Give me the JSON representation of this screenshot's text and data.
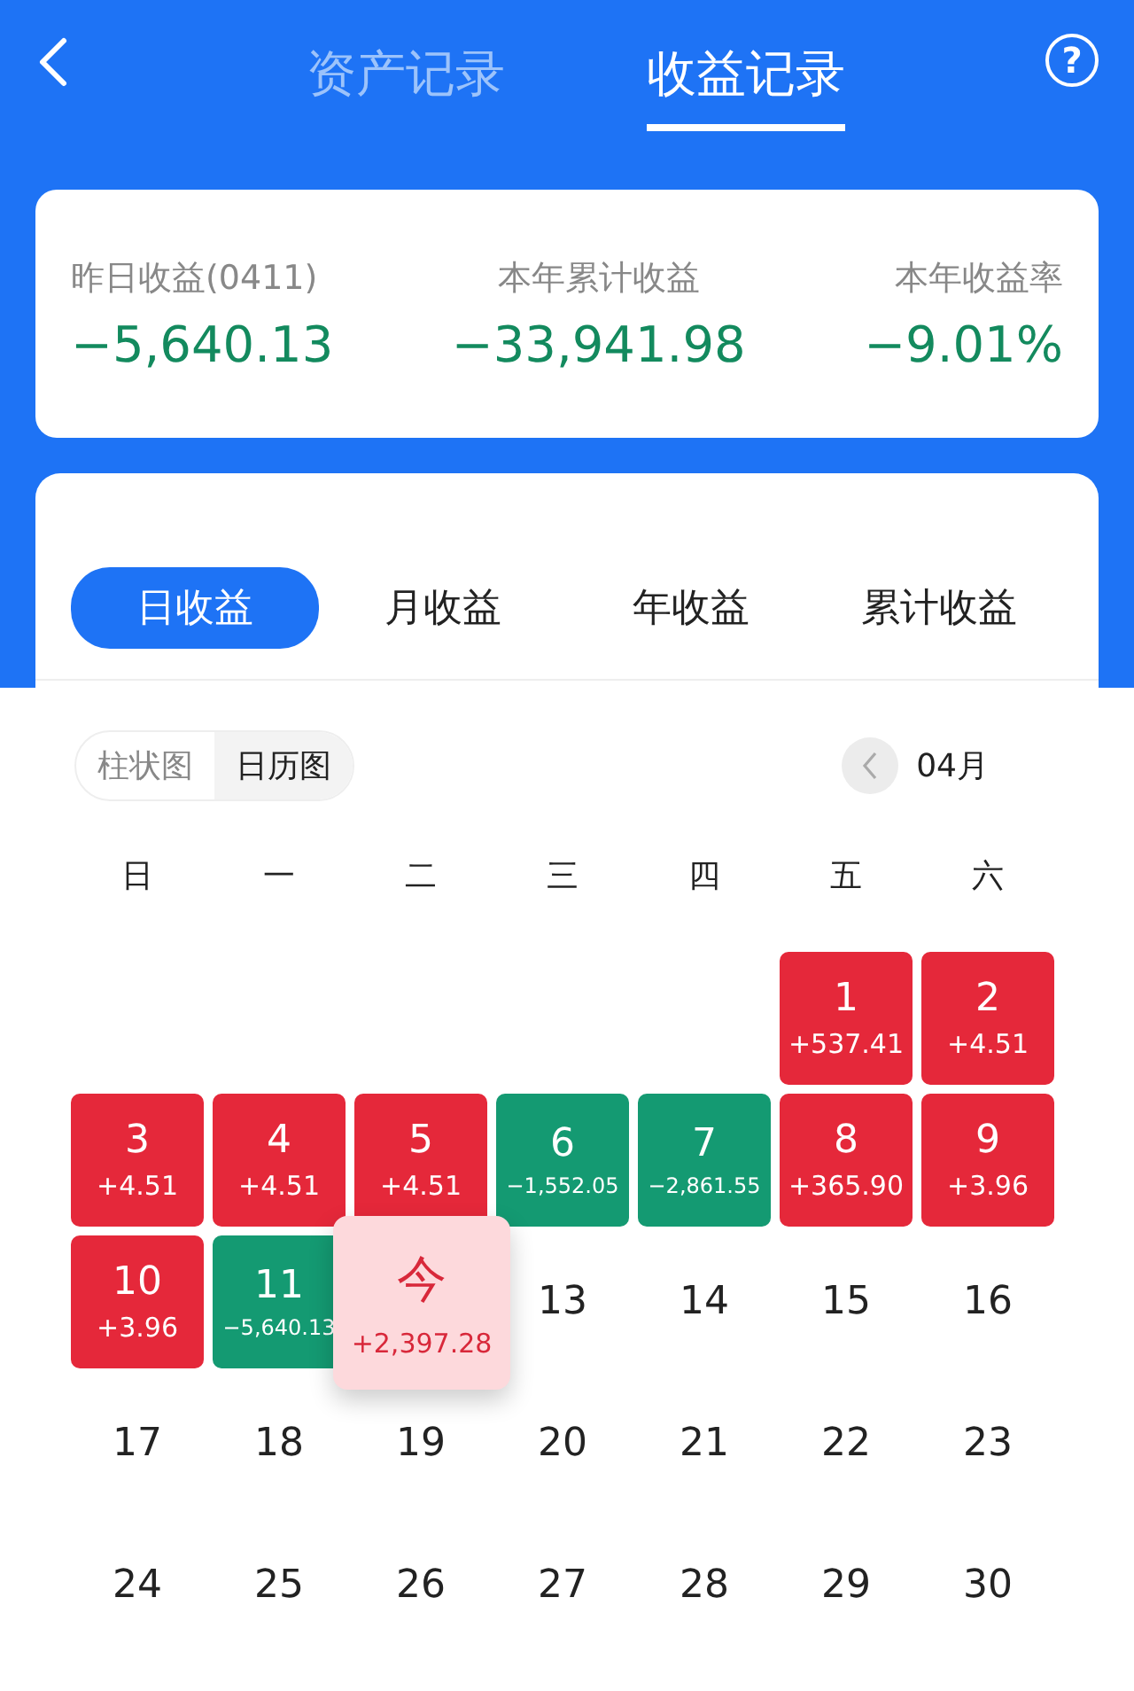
{
  "header": {
    "tabs": [
      {
        "label": "资产记录",
        "selected": false
      },
      {
        "label": "收益记录",
        "selected": true
      }
    ],
    "help": "?"
  },
  "summary": [
    {
      "label": "昨日收益(0411)",
      "value": "−5,640.13"
    },
    {
      "label": "本年累计收益",
      "value": "−33,941.98"
    },
    {
      "label": "本年收益率",
      "value": "−9.01%"
    }
  ],
  "periods": [
    {
      "label": "日收益",
      "selected": true
    },
    {
      "label": "月收益",
      "selected": false
    },
    {
      "label": "年收益",
      "selected": false
    },
    {
      "label": "累计收益",
      "selected": false
    }
  ],
  "views": [
    {
      "label": "柱状图",
      "selected": false
    },
    {
      "label": "日历图",
      "selected": true
    }
  ],
  "month": "04月",
  "weekdays": [
    "日",
    "一",
    "二",
    "三",
    "四",
    "五",
    "六"
  ],
  "days": [
    {
      "kind": "empty"
    },
    {
      "kind": "empty"
    },
    {
      "kind": "empty"
    },
    {
      "kind": "empty"
    },
    {
      "kind": "empty"
    },
    {
      "kind": "gain",
      "day": "1",
      "amount": "+537.41"
    },
    {
      "kind": "gain",
      "day": "2",
      "amount": "+4.51"
    },
    {
      "kind": "gain",
      "day": "3",
      "amount": "+4.51"
    },
    {
      "kind": "gain",
      "day": "4",
      "amount": "+4.51"
    },
    {
      "kind": "gain",
      "day": "5",
      "amount": "+4.51"
    },
    {
      "kind": "loss",
      "day": "6",
      "amount": "−1,552.05"
    },
    {
      "kind": "loss",
      "day": "7",
      "amount": "−2,861.55"
    },
    {
      "kind": "gain",
      "day": "8",
      "amount": "+365.90"
    },
    {
      "kind": "gain",
      "day": "9",
      "amount": "+3.96"
    },
    {
      "kind": "gain",
      "day": "10",
      "amount": "+3.96"
    },
    {
      "kind": "loss",
      "day": "11",
      "amount": "−5,640.13"
    },
    {
      "kind": "today",
      "day": "今",
      "amount": "+2,397.28"
    },
    {
      "kind": "plain",
      "day": "13"
    },
    {
      "kind": "plain",
      "day": "14"
    },
    {
      "kind": "plain",
      "day": "15"
    },
    {
      "kind": "plain",
      "day": "16"
    },
    {
      "kind": "plain",
      "day": "17"
    },
    {
      "kind": "plain",
      "day": "18"
    },
    {
      "kind": "plain",
      "day": "19"
    },
    {
      "kind": "plain",
      "day": "20"
    },
    {
      "kind": "plain",
      "day": "21"
    },
    {
      "kind": "plain",
      "day": "22"
    },
    {
      "kind": "plain",
      "day": "23"
    },
    {
      "kind": "plain",
      "day": "24"
    },
    {
      "kind": "plain",
      "day": "25"
    },
    {
      "kind": "plain",
      "day": "26"
    },
    {
      "kind": "plain",
      "day": "27"
    },
    {
      "kind": "plain",
      "day": "28"
    },
    {
      "kind": "plain",
      "day": "29"
    },
    {
      "kind": "plain",
      "day": "30"
    }
  ]
}
